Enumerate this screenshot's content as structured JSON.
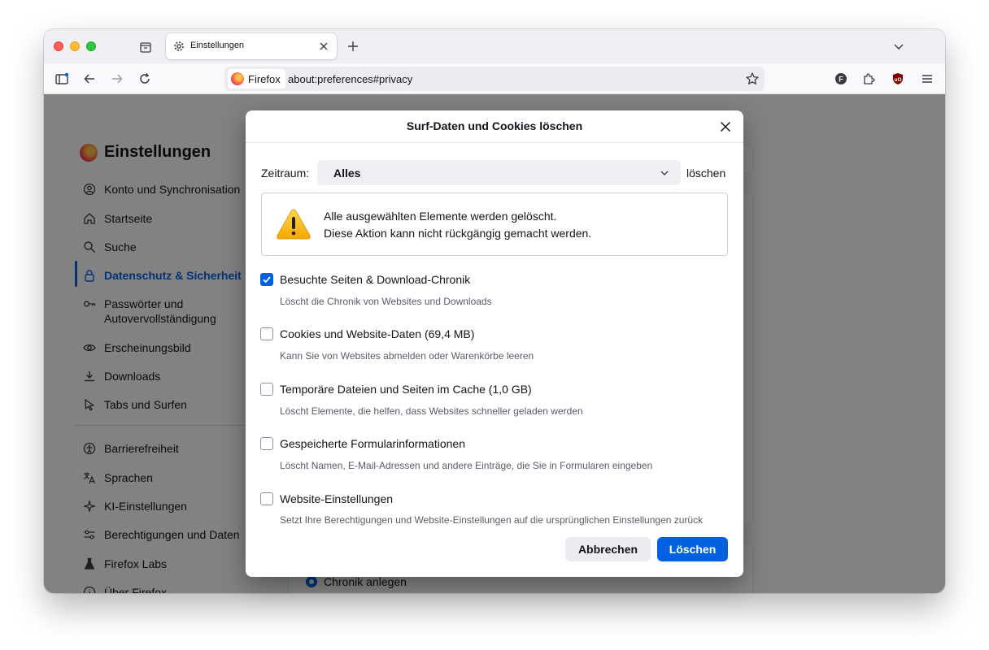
{
  "window": {
    "tab": {
      "title": "Einstellungen"
    },
    "urlbar": {
      "identity_label": "Firefox",
      "url": "about:preferences#privacy"
    }
  },
  "preferences": {
    "title": "Einstellungen",
    "nav": [
      {
        "label": "Konto und Synchronisation",
        "icon": "account-icon"
      },
      {
        "label": "Startseite",
        "icon": "home-icon"
      },
      {
        "label": "Suche",
        "icon": "search-icon"
      },
      {
        "label": "Datenschutz & Sicherheit",
        "icon": "lock-icon",
        "active": true
      },
      {
        "label": "Passwörter und\nAutovervollständigung",
        "icon": "key-icon"
      },
      {
        "label": "Erscheinungsbild",
        "icon": "eye-icon"
      },
      {
        "label": "Downloads",
        "icon": "download-icon"
      },
      {
        "label": "Tabs und Surfen",
        "icon": "pointer-icon"
      },
      {
        "label": "Barrierefreiheit",
        "icon": "accessibility-icon"
      },
      {
        "label": "Sprachen",
        "icon": "translate-icon"
      },
      {
        "label": "KI-Einstellungen",
        "icon": "sparkle-icon"
      },
      {
        "label": "Berechtigungen und Daten",
        "icon": "sliders-icon"
      },
      {
        "label": "Firefox Labs",
        "icon": "flask-icon"
      },
      {
        "label": "Über Firefox",
        "icon": "info-icon"
      }
    ],
    "background_radio_label": "Chronik anlegen"
  },
  "dialog": {
    "title": "Surf-Daten und Cookies löschen",
    "time_range": {
      "label": "Zeitraum:",
      "value": "Alles",
      "suffix": "löschen"
    },
    "warning": {
      "line1": "Alle ausgewählten Elemente werden gelöscht.",
      "line2": "Diese Aktion kann nicht rückgängig gemacht werden."
    },
    "options": [
      {
        "label": "Besuchte Seiten & Download-Chronik",
        "desc": "Löscht die Chronik von Websites und Downloads",
        "checked": true
      },
      {
        "label": "Cookies und Website-Daten (69,4 MB)",
        "desc": "Kann Sie von Websites abmelden oder Warenkörbe leeren",
        "checked": false
      },
      {
        "label": "Temporäre Dateien und Seiten im Cache (1,0 GB)",
        "desc": "Löscht Elemente, die helfen, dass Websites schneller geladen werden",
        "checked": false
      },
      {
        "label": "Gespeicherte Formularinformationen",
        "desc": "Löscht Namen, E-Mail-Adressen und andere Einträge, die Sie in Formularen eingeben",
        "checked": false
      },
      {
        "label": "Website-Einstellungen",
        "desc": "Setzt Ihre Berechtigungen und Website-Einstellungen auf die ursprünglichen Einstellungen zurück",
        "checked": false
      }
    ],
    "cancel_label": "Abbrechen",
    "ok_label": "Löschen"
  },
  "colors": {
    "accent": "#0061e0",
    "overlay": "rgba(0,0,0,0.48)"
  }
}
